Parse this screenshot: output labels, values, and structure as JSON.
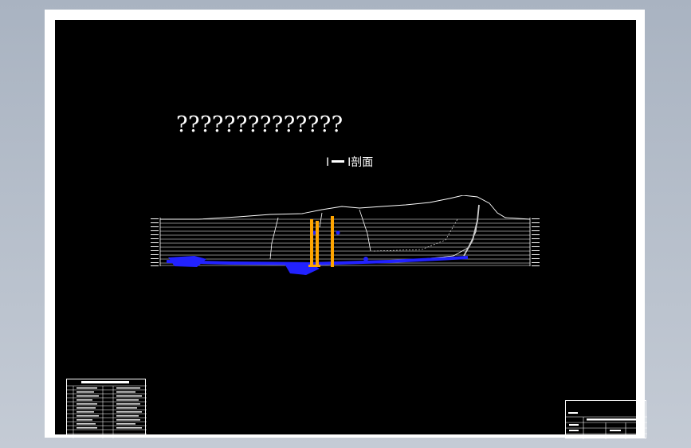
{
  "drawing": {
    "title": "??????????????",
    "section_label_roman": "I",
    "section_label_roman_2": "I",
    "section_label_text": "剖面"
  },
  "colors": {
    "background": "#000000",
    "frame": "#ffffff",
    "aquifer": "#2222ff",
    "boreholes": "#ffa500",
    "terrain": "#ffffff"
  }
}
